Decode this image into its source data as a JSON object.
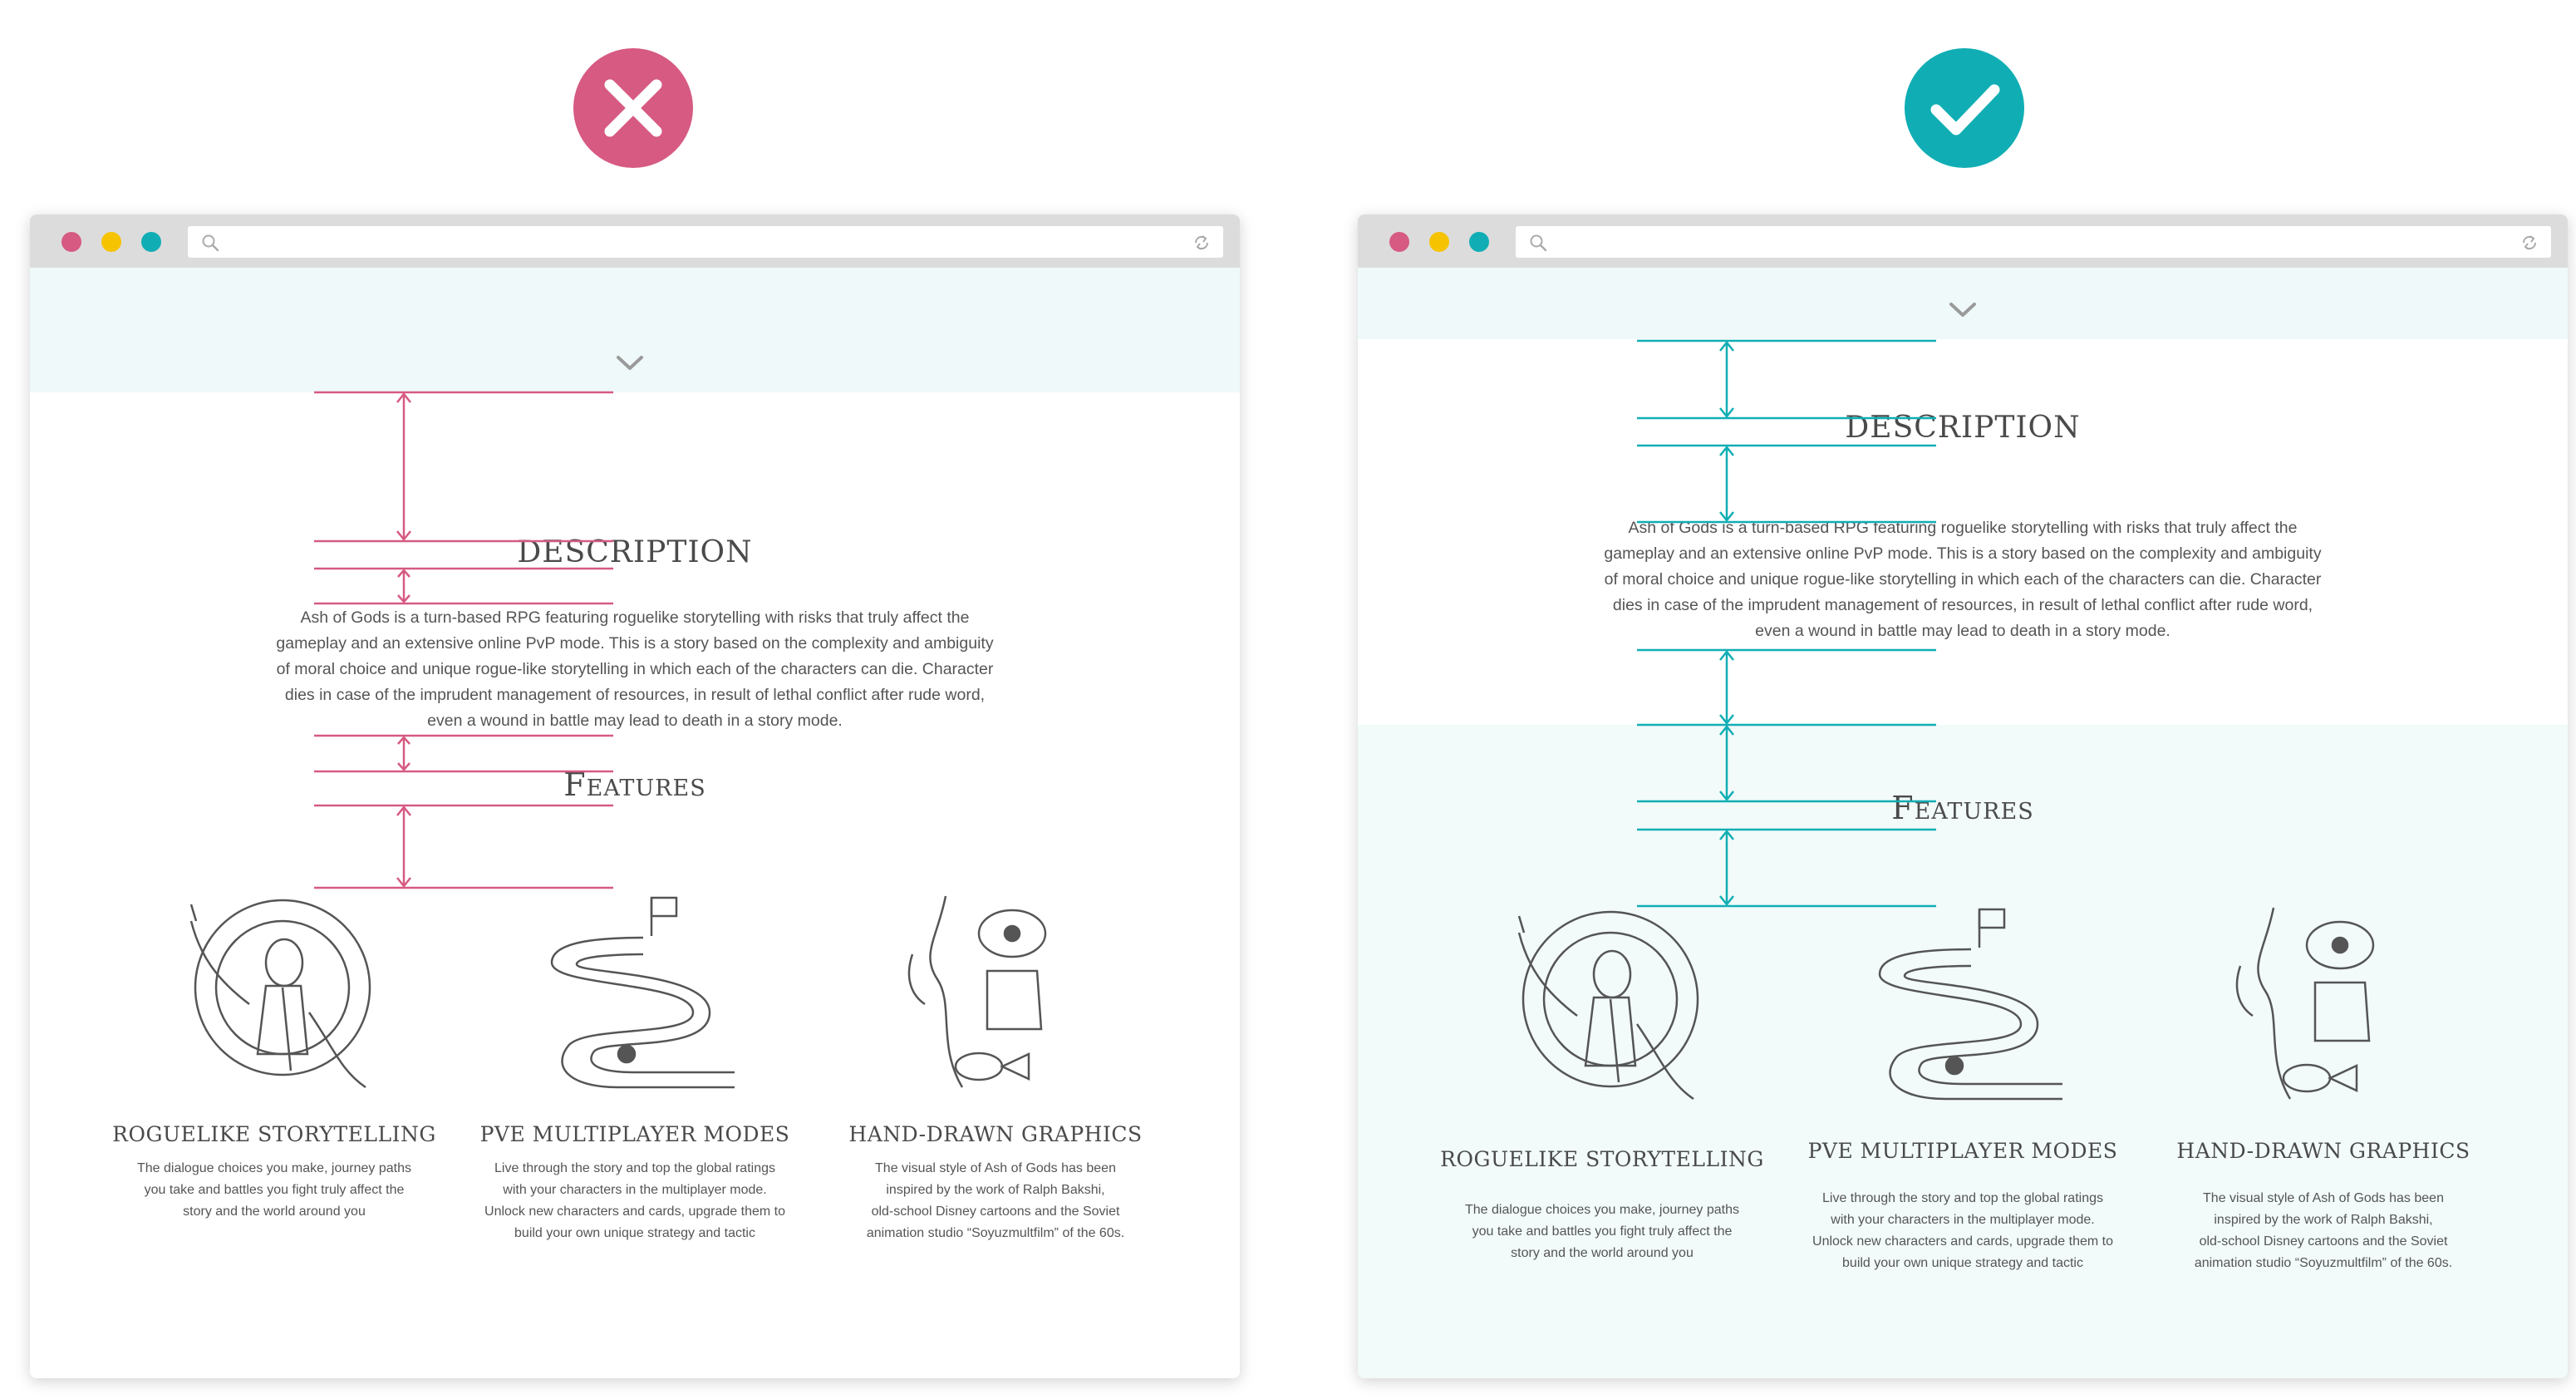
{
  "colors": {
    "bad": "#d65a82",
    "good": "#10aeb4",
    "hero_band": "#f0f9f9",
    "text": "#555555",
    "heading": "#4a4a4a"
  },
  "badges": {
    "bad_icon": "cross-icon",
    "good_icon": "check-icon"
  },
  "browser": {
    "controls": [
      "close-dot",
      "minimize-dot",
      "maximize-dot"
    ],
    "icons": [
      "search-icon",
      "reload-icon"
    ]
  },
  "content": {
    "description_title": "DESCRIPTION",
    "description_lines": [
      "Ash of Gods is a turn-based RPG featuring roguelike storytelling with risks that truly affect the",
      "gameplay and an extensive online PvP mode. This is a story based on the complexity and ambiguity",
      "of moral choice and unique rogue-like storytelling in which each of the characters can die. Character",
      "dies in case of the imprudent management of resources, in result of lethal conflict after rude word,",
      "even a wound in battle may lead to death in a story mode."
    ],
    "features_title": "Features",
    "features": [
      {
        "title": "ROGUELIKE STORYTELLING",
        "lines": [
          "The dialogue choices you make, journey paths",
          "you take and battles you fight truly affect the",
          "story and the world around you"
        ]
      },
      {
        "title": "PVE MULTIPLAYER MODES",
        "lines": [
          "Live through the story and top the global ratings",
          "with your characters in the multiplayer mode.",
          "Unlock new characters and cards, upgrade them to",
          "build your own unique strategy and tactic"
        ]
      },
      {
        "title": "HAND-DRAWN GRAPHICS",
        "lines": [
          "The visual style of Ash of Gods has been",
          "inspired by the work of Ralph Bakshi,",
          "old-school Disney cartoons and the Soviet",
          "animation studio “Soyuzmultfilm” of the 60s."
        ]
      }
    ]
  }
}
